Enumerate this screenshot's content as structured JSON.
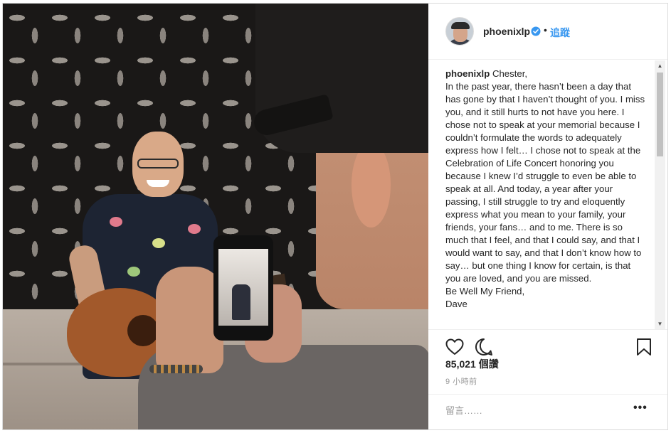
{
  "header": {
    "username": "phoenixlp",
    "verified": true,
    "separator": "•",
    "follow_label": "追蹤"
  },
  "caption": {
    "username": "phoenixlp",
    "lines": [
      "Chester,",
      "In the past year, there hasn’t been a day that has gone by that I haven’t thought of you. I miss you, and it still hurts to not have you here. I chose not to speak at your memorial because I couldn’t formulate the words to adequately express how I felt… I chose not to speak at the Celebration of Life Concert honoring you because I knew I’d struggle to even be able to speak at all. And today, a year after your passing, I still struggle to try and eloquently express what you mean to your family, your friends, your fans… and to me. There is so much that I feel, and that I could say, and that I would want to say, and that I don’t know how to say… but one thing I know for certain, is that you are loved, and you are missed.",
      "Be Well My Friend,",
      "Dave"
    ]
  },
  "actions": {
    "like_icon": "heart-icon",
    "comment_icon": "comment-bubble-icon",
    "save_icon": "bookmark-icon"
  },
  "likes": "85,021 個讚",
  "timestamp": "9 小時前",
  "comment_box": {
    "placeholder": "留言……",
    "more_label": "•••"
  },
  "colors": {
    "accent": "#3897f0",
    "text": "#262626",
    "muted": "#999999",
    "border": "#efefef"
  }
}
